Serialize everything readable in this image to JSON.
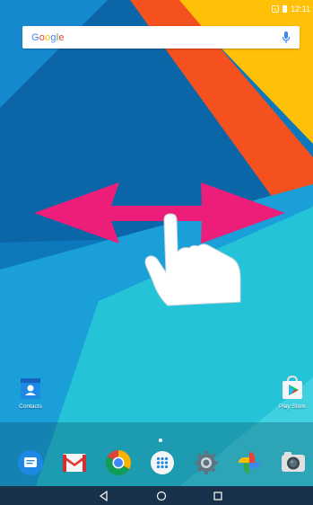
{
  "status_bar": {
    "time": "12:11"
  },
  "search": {
    "logo_letters": [
      "G",
      "o",
      "o",
      "g",
      "l",
      "e"
    ]
  },
  "desktop": {
    "contacts_label": "Contacts",
    "play_store_label": "Play Store"
  },
  "dock": {
    "apps": [
      "messages-icon",
      "gmail-icon",
      "chrome-icon",
      "app-drawer-icon",
      "settings-icon",
      "photos-icon",
      "camera-icon"
    ]
  },
  "navigation": {
    "buttons": [
      "back-icon",
      "home-icon",
      "recents-icon"
    ]
  },
  "colors": {
    "wallpaper_blue": "#0f7fc4",
    "wallpaper_cyan": "#25c3d8",
    "orange": "#f4511e",
    "yellow": "#ffc107",
    "gesture_arrow": "#ec1e7a"
  }
}
